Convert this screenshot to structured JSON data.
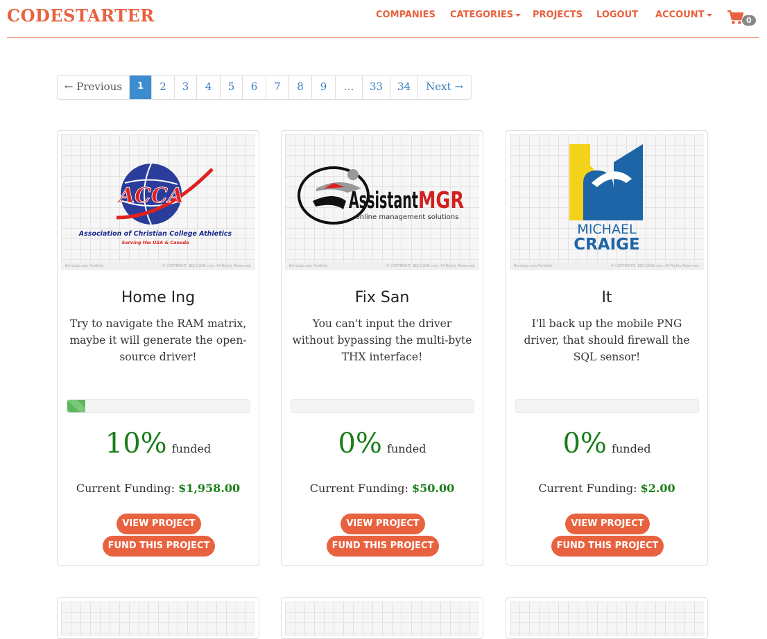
{
  "navbar": {
    "brand": "CODESTARTER",
    "links": [
      "COMPANIES",
      "CATEGORIES",
      "PROJECTS",
      "LOGOUT",
      "ACCOUNT"
    ],
    "cart_count": "0",
    "accent": "#e8623f"
  },
  "pagination": {
    "prev": "← Previous",
    "pages": [
      "1",
      "2",
      "3",
      "4",
      "5",
      "6",
      "7",
      "8",
      "9",
      "…",
      "33",
      "34"
    ],
    "active": "1",
    "next": "Next →"
  },
  "projects": [
    {
      "title": "Home Ing",
      "description": "Try to navigate the RAM matrix, maybe it will generate the open-source driver!",
      "progress": 0.1,
      "percent": "10%",
      "funded_label": "funded",
      "funding_label": "Current Funding:",
      "funding_amount": "$1,958.00",
      "view_label": "VIEW PROJECT",
      "fund_label": "FUND THIS PROJECT",
      "logo": {
        "name": "acca-logo",
        "title": "ACCA",
        "line1": "Association of Christian College Athletics",
        "line2": "Serving the USA & Canada"
      },
      "thumb_footer_left": "Biz-Logo.com Portfolio",
      "thumb_footer_right": "© COPYRIGHT, BIZ-LOGO.com. All Rights Reserved."
    },
    {
      "title": "Fix San",
      "description": "You can't input the driver without bypassing the multi-byte THX interface!",
      "progress": 0.0,
      "percent": "0%",
      "funded_label": "funded",
      "funding_label": "Current Funding:",
      "funding_amount": "$50.00",
      "view_label": "VIEW PROJECT",
      "fund_label": "FUND THIS PROJECT",
      "logo": {
        "name": "assistantmgr-logo",
        "title_a": "Assistant",
        "title_b": "MGR",
        "line1": "online management solutions"
      },
      "thumb_footer_left": "Biz-Logo.com Portfolio",
      "thumb_footer_right": "© COPYRIGHT, BIZ-LOGO.com. All Rights Reserved."
    },
    {
      "title": "It",
      "description": "I'll back up the mobile PNG driver, that should firewall the SQL sensor!",
      "progress": 0.0,
      "percent": "0%",
      "funded_label": "funded",
      "funding_label": "Current Funding:",
      "funding_amount": "$2.00",
      "view_label": "VIEW PROJECT",
      "fund_label": "FUND THIS PROJECT",
      "logo": {
        "name": "michael-craige-logo",
        "line1": "MICHAEL",
        "line2": "CRAIGE"
      },
      "thumb_footer_left": "Biz-Logo.com Portfolio",
      "thumb_footer_right": "© COPYRIGHT, BIZ-LOGO.com. All Rights Reserved."
    }
  ]
}
